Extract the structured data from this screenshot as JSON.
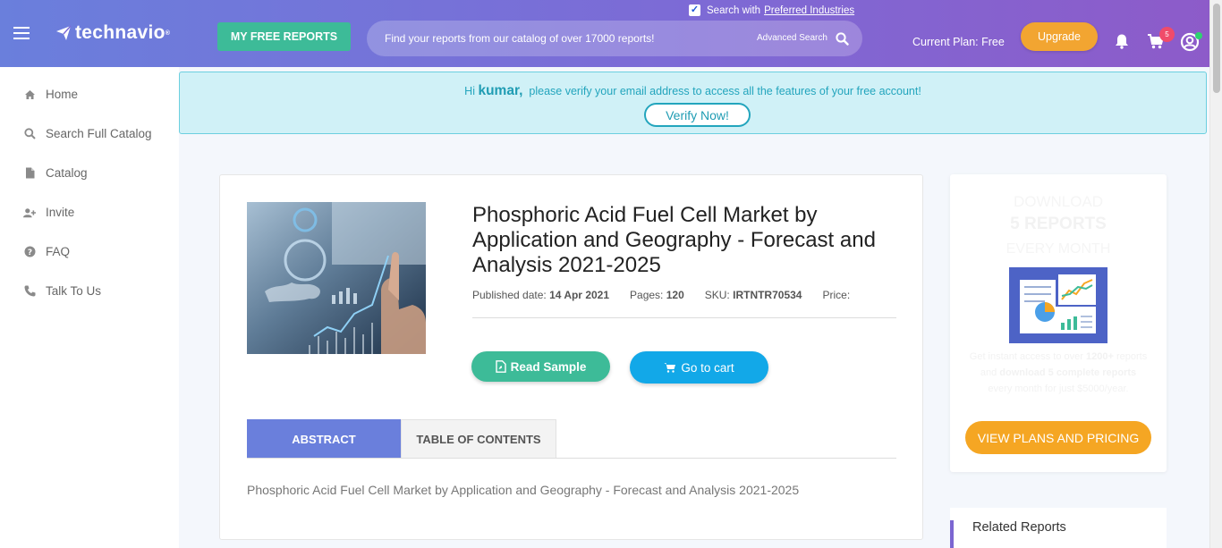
{
  "header": {
    "logo_text": "technavio",
    "logo_tm": "®",
    "free_reports_label": "MY FREE REPORTS",
    "preferred": {
      "prefix": "Search with",
      "link": "Preferred Industries",
      "checked": true
    },
    "search": {
      "placeholder": "Find your reports from our catalog of over 17000 reports!",
      "advanced_label": "Advanced Search"
    },
    "current_plan": "Current Plan: Free",
    "upgrade_label": "Upgrade",
    "cart_count": "5",
    "icons": [
      "menu-icon",
      "technavio-logo-icon",
      "search-icon",
      "bell-icon",
      "cart-icon",
      "user-icon"
    ]
  },
  "sidebar": {
    "items": [
      {
        "label": "Home",
        "icon": "home-icon"
      },
      {
        "label": "Search Full Catalog",
        "icon": "search-icon"
      },
      {
        "label": "Catalog",
        "icon": "file-icon"
      },
      {
        "label": "Invite",
        "icon": "user-plus-icon"
      },
      {
        "label": "FAQ",
        "icon": "question-icon"
      },
      {
        "label": "Talk To Us",
        "icon": "phone-icon"
      }
    ]
  },
  "verify": {
    "greeting": "Hi",
    "name": "kumar,",
    "message": "please verify your email address to access all the features of your free account!",
    "button": "Verify Now!"
  },
  "report": {
    "title": "Phosphoric Acid Fuel Cell Market by Application and Geography - Forecast and Analysis 2021-2025",
    "published_label": "Published date:",
    "published_value": "14 Apr 2021",
    "pages_label": "Pages:",
    "pages_value": "120",
    "sku_label": "SKU:",
    "sku_value": "IRTNTR70534",
    "price_label": "Price:",
    "read_sample": "Read Sample",
    "go_to_cart": "Go to cart",
    "tabs": [
      "ABSTRACT",
      "TABLE OF CONTENTS"
    ],
    "active_tab": "ABSTRACT",
    "abstract": "Phosphoric Acid Fuel Cell Market by Application and Geography - Forecast and Analysis 2021-2025"
  },
  "promo": {
    "line1": "DOWNLOAD",
    "line2": "5 REPORTS",
    "line3": "EVERY MONTH",
    "desc_1": "Get instant access to over",
    "desc_2": "1200+",
    "desc_3": "reports and",
    "desc_4": "download 5 complete reports",
    "desc_5": "every month for just $5000/year.",
    "button": "VIEW PLANS AND PRICING"
  },
  "related": {
    "label": "Related Reports"
  },
  "colors": {
    "header_start": "#6a7fdc",
    "header_end": "#8d5bc9",
    "green": "#3dbb98",
    "blue": "#12a8e8",
    "orange": "#f5a623",
    "verify_bg": "#d0f1f7"
  }
}
